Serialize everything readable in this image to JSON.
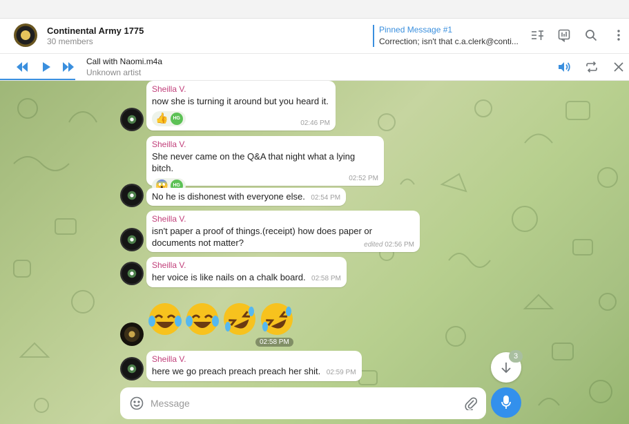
{
  "header": {
    "title": "Continental Army 1775",
    "members": "30 members",
    "pinned_label": "Pinned Message #1",
    "pinned_text": "Correction; isn't that c.a.clerk@conti..."
  },
  "player": {
    "track": "Call with Naomi.m4a",
    "artist": "Unknown artist",
    "progress": 0.12
  },
  "messages": [
    {
      "sender": "Sheilla V.",
      "text": "now she is turning it around but you heard it.",
      "time": "02:46 PM",
      "reaction": "👍"
    },
    {
      "sender": "Sheilla V.",
      "text": "She never came on the Q&A that night what a lying bitch.",
      "time": "02:52 PM",
      "reaction": "😱"
    },
    {
      "text": "No he is dishonest with everyone else.",
      "time": "02:54 PM"
    },
    {
      "sender": "Sheilla V.",
      "text": "isn't paper a proof of things.(receipt) how does paper or documents not matter?",
      "edited": "edited",
      "time": "02:56 PM"
    },
    {
      "sender": "Sheilla V.",
      "text": "her voice is like nails on a chalk board.",
      "time": "02:58 PM"
    },
    {
      "sender": "Sheilla V.",
      "text": "here we go preach preach preach her shit.",
      "time": "02:59 PM"
    }
  ],
  "stickers": {
    "items": [
      "😂",
      "😂",
      "🤣",
      "🤣"
    ],
    "time": "02:58 PM"
  },
  "reaction_avatar_initials": "HG",
  "scroll_down_badge": "3",
  "composer": {
    "placeholder": "Message"
  },
  "colors": {
    "accent": "#3a8fde",
    "sender_name": "#c13f7a",
    "mic_button": "#3390ec"
  },
  "icons": [
    "play-previous-icon",
    "play-icon",
    "play-next-icon",
    "volume-icon",
    "repeat-icon",
    "close-icon",
    "filter-icon",
    "poll-icon",
    "search-icon",
    "more-vertical-icon",
    "emoji-icon",
    "attach-icon",
    "microphone-icon",
    "arrow-down-icon"
  ]
}
